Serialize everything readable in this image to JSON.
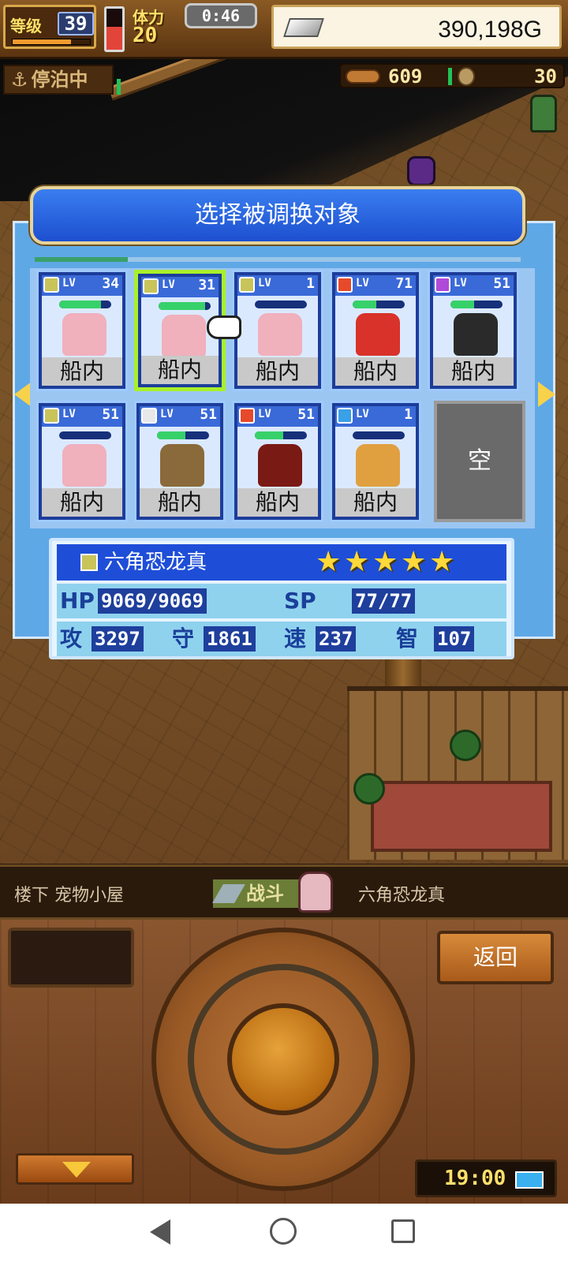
{
  "hud": {
    "level_label": "等级",
    "level": "39",
    "level_progress": 0.75,
    "stamina_label": "体力",
    "stamina": "20",
    "stamina_gauge": 0.55,
    "timer": "0:46",
    "money": "390,198G",
    "docked_label": "停泊中",
    "food_count": "609",
    "medal_count": "30"
  },
  "dialog": {
    "title": "选择被调换对象"
  },
  "pets": [
    {
      "element_color": "#c9c45a",
      "lv_label": "LV",
      "level": "34",
      "hp": 0.8,
      "sprite_color": "#f0b0bc",
      "location": "船内",
      "selected": false
    },
    {
      "element_color": "#c9c45a",
      "lv_label": "LV",
      "level": "31",
      "hp": 0.9,
      "sprite_color": "#f0b0bc",
      "location": "船内",
      "selected": true
    },
    {
      "element_color": "#c9c45a",
      "lv_label": "LV",
      "level": "1",
      "hp": 0.0,
      "sprite_color": "#f0b0bc",
      "location": "船内",
      "selected": false
    },
    {
      "element_color": "#e64a2a",
      "lv_label": "LV",
      "level": "71",
      "hp": 0.45,
      "sprite_color": "#d8322a",
      "location": "船内",
      "selected": false
    },
    {
      "element_color": "#b04ad8",
      "lv_label": "LV",
      "level": "51",
      "hp": 0.45,
      "sprite_color": "#2a2a2a",
      "location": "船内",
      "selected": false
    },
    {
      "element_color": "#c9c45a",
      "lv_label": "LV",
      "level": "51",
      "hp": 0.0,
      "sprite_color": "#f0b0bc",
      "location": "船内",
      "selected": false
    },
    {
      "element_color": "#e8e8e8",
      "lv_label": "LV",
      "level": "51",
      "hp": 0.55,
      "sprite_color": "#8a6a3a",
      "location": "船内",
      "selected": false
    },
    {
      "element_color": "#e64a2a",
      "lv_label": "LV",
      "level": "51",
      "hp": 0.55,
      "sprite_color": "#7a1a14",
      "location": "船内",
      "selected": false
    },
    {
      "element_color": "#3aa0e8",
      "lv_label": "LV",
      "level": "1",
      "hp": 0.0,
      "sprite_color": "#e0a040",
      "location": "船内",
      "selected": false
    }
  ],
  "empty_slot_label": "空",
  "detail": {
    "name": "六角恐龙真",
    "element_color": "#c9c45a",
    "stars": 5,
    "hp_label": "HP",
    "hp_value": "9069/9069",
    "sp_label": "SP",
    "sp_value": "77/77",
    "atk_label": "攻",
    "atk_value": "3297",
    "def_label": "守",
    "def_value": "1861",
    "spd_label": "速",
    "spd_value": "237",
    "int_label": "智",
    "int_value": "107"
  },
  "status": {
    "location": "楼下 宠物小屋",
    "battle_label": "战斗",
    "battle_pet": "六角恐龙真"
  },
  "controls": {
    "back_label": "返回",
    "clock": "19:00"
  },
  "icons": {
    "star": "★",
    "anchor": "⚓"
  }
}
